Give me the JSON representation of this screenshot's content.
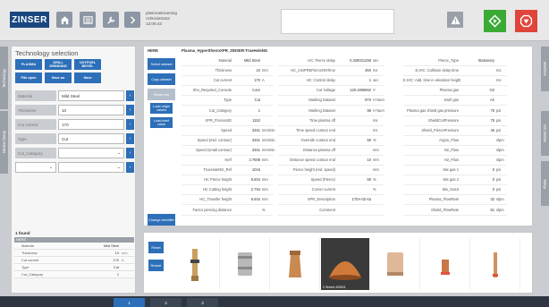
{
  "header": {
    "logo_text": "ZINSER",
    "user_line1": "plasmastreaming",
    "user_line2": "Administrator",
    "user_line3": "13:06:43",
    "icons": [
      "home-icon",
      "list-icon",
      "wrench-icon",
      "chevron-right-icon",
      "warning-icon",
      "start-icon",
      "stop-icon"
    ],
    "start_color": "#3aaa35",
    "stop_color": "#e0453b"
  },
  "side_tabs": {
    "left": [
      "Technology",
      "Device Setup"
    ],
    "right": [
      "Machine",
      "ISC Button",
      "Setup"
    ]
  },
  "tech": {
    "title": "Technology selection",
    "buttons": [
      "PLASMA",
      "DRILL GRINDING",
      "OXYFUEL BEVEL"
    ],
    "actions": [
      "File open",
      "Save as",
      "Save"
    ],
    "fields": [
      {
        "label": "Material",
        "value": "Mild Steel"
      },
      {
        "label": "Thickness",
        "value": "10"
      },
      {
        "label": "Cut current",
        "value": "170"
      },
      {
        "label": "Type",
        "value": "Cut"
      },
      {
        "label": "Cut_Category",
        "value": ""
      }
    ],
    "found_label": "1 found",
    "summary_header": "HERE",
    "summary_rows": [
      {
        "k": "Material",
        "v": "Mild Steel",
        "u": ""
      },
      {
        "k": "Thickness",
        "v": "10",
        "u": "mm"
      },
      {
        "k": "Cut current",
        "v": "170",
        "u": "A"
      },
      {
        "k": "Type",
        "v": "Cut",
        "u": ""
      },
      {
        "k": "Cut_Category",
        "v": "1",
        "u": ""
      }
    ]
  },
  "main": {
    "header": "HERE",
    "title": "Plasma_HypertthermXPR_ZINSER-TrueHoleNG",
    "buttons": [
      "Select dataset",
      "Copy dataset",
      "Reset row",
      "Load origin values",
      "Load start value",
      "Change identifier"
    ],
    "col1": [
      {
        "l": "Material",
        "v": "Mild Steel",
        "u": ""
      },
      {
        "l": "Thickness",
        "v": "10",
        "u": "mm"
      },
      {
        "l": "Cut current",
        "v": "170",
        "u": "A"
      },
      {
        "l": "Xho_Required_Console",
        "v": "Core",
        "u": ""
      },
      {
        "l": "Type",
        "v": "Cut",
        "u": ""
      },
      {
        "l": "Cut_Category",
        "v": "1",
        "u": ""
      },
      {
        "l": "XPR_ProcessID",
        "v": "1152",
        "u": ""
      },
      {
        "l": "Speed",
        "v": "3461",
        "u": "mm/min"
      },
      {
        "l": "Speed (mid. contour)",
        "v": "3461",
        "u": "mm/min"
      },
      {
        "l": "Speed (small contour)",
        "v": "3461",
        "u": "mm/min"
      },
      {
        "l": "Kerf",
        "v": "2.7598",
        "u": "mm"
      },
      {
        "l": "TrueHoleNG_Ref",
        "v": "1016",
        "u": ""
      },
      {
        "l": "HC Pierce height",
        "v": "6.604",
        "u": "mm"
      },
      {
        "l": "HC Cutting height",
        "v": "2.794",
        "u": "mm"
      },
      {
        "l": "HC_Transfer height",
        "v": "6.604",
        "u": "mm"
      },
      {
        "l": "Factor piercing distance",
        "v": "",
        "u": "%"
      }
    ],
    "col2": [
      {
        "l": "HC: Pierce delay",
        "v": "0.329021258",
        "u": "sec"
      },
      {
        "l": "HC_minPREPierceONTime",
        "v": "450",
        "u": "ms"
      },
      {
        "l": "HC: Control delay",
        "v": "1",
        "u": "sec"
      },
      {
        "l": "Cut Voltage",
        "v": "128.1996962",
        "u": "V"
      },
      {
        "l": "Marking Dataset",
        "v": "970",
        "u": "H Num"
      },
      {
        "l": "Marking Dataset",
        "v": "98",
        "u": "H Num"
      },
      {
        "l": "Time plasma off",
        "v": "",
        "u": "ms"
      },
      {
        "l": "Time speed contour end",
        "v": "",
        "u": "ms"
      },
      {
        "l": "Override contour end",
        "v": "50",
        "u": "%"
      },
      {
        "l": "Distance plasma off",
        "v": "",
        "u": "mm"
      },
      {
        "l": "Distance speed contour end",
        "v": "10",
        "u": "mm"
      },
      {
        "l": "Pierce height (red. speed)",
        "v": "",
        "u": "mm"
      },
      {
        "l": "Speed (Pierce)",
        "v": "60",
        "u": "%"
      },
      {
        "l": "Corner current",
        "v": "",
        "u": "%"
      },
      {
        "l": "XPR_Description",
        "v": "170A-02-4a",
        "u": ""
      },
      {
        "l": "Comment",
        "v": "",
        "u": ""
      }
    ],
    "col3": [
      {
        "l": "Pierce_Type",
        "v": "Stationary",
        "u": ""
      },
      {
        "l": "E.IHC: Collision delay time",
        "v": "",
        "u": "ms"
      },
      {
        "l": "E.IHC: Add. time in elevation height",
        "v": "",
        "u": "ms"
      },
      {
        "l": "Plasma gas",
        "v": "O2",
        "u": ""
      },
      {
        "l": "Swirl gas",
        "v": "Air",
        "u": ""
      },
      {
        "l": "Plasma gas shield gas pressure",
        "v": "75",
        "u": "psi"
      },
      {
        "l": "ShieldCutPressure",
        "v": "75",
        "u": "psi"
      },
      {
        "l": "Shield_PiercePressure",
        "v": "45",
        "u": "psi"
      },
      {
        "l": "Argon_Flow",
        "v": "",
        "u": "slpm"
      },
      {
        "l": "N2_Flow",
        "v": "",
        "u": "slpm"
      },
      {
        "l": "H2_Flow",
        "v": "",
        "u": "slpm"
      },
      {
        "l": "Mix gas 1",
        "v": "0",
        "u": "psi"
      },
      {
        "l": "Mix gas 2",
        "v": "0",
        "u": "psi"
      },
      {
        "l": "Mix_Gas3",
        "v": "0",
        "u": "psi"
      },
      {
        "l": "Plasma_FlowRate",
        "v": "32",
        "u": "slpm"
      },
      {
        "l": "Shield_FlowRate",
        "v": "51",
        "u": "slpm"
      }
    ]
  },
  "images": {
    "buttons": [
      "Reset",
      "Resize"
    ],
    "selected_caption": "2 Shield 420511"
  },
  "pager": {
    "pages": [
      "1",
      "2",
      "3"
    ],
    "active": "1"
  }
}
